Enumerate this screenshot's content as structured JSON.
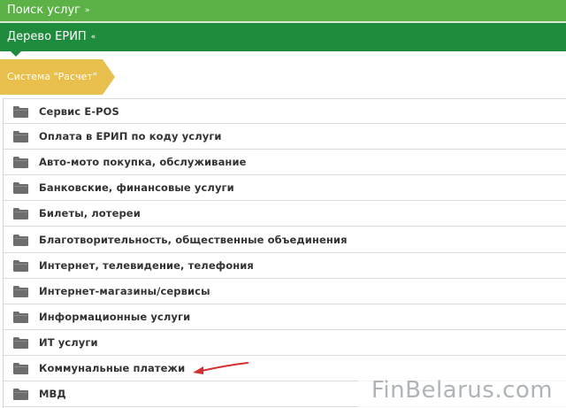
{
  "header": {
    "search_label": "Поиск услуг",
    "search_chevron": "»",
    "tree_label": "Дерево ЕРИП",
    "tree_chevron": "«"
  },
  "breadcrumb": {
    "label": "Система \"Расчет\""
  },
  "categories": [
    "Сервис E-POS",
    "Оплата в ЕРИП по коду услуги",
    "Авто-мото покупка, обслуживание",
    "Банковские, финансовые услуги",
    "Билеты, лотереи",
    "Благотворительность, общественные объединения",
    "Интернет, телевидение, телефония",
    "Интернет-магазины/сервисы",
    "Информационные услуги",
    "ИТ услуги",
    "Коммунальные платежи",
    "МВД"
  ],
  "watermark": "FinBelarus.com",
  "colors": {
    "header_light_green": "#5cb247",
    "header_dark_green": "#1f8c3d",
    "breadcrumb_yellow": "#e9bf4d",
    "folder_gray": "#6d6d6d",
    "arrow_red": "#d32f2f"
  },
  "icons": {
    "row_icon": "folder-icon",
    "annotation": "red-arrow-icon"
  }
}
